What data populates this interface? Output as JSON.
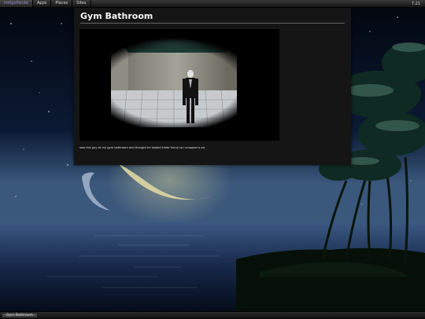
{
  "top_panel": {
    "menu_items": [
      {
        "label": "IndigoPanda"
      },
      {
        "label": "Apps"
      },
      {
        "label": "Places"
      },
      {
        "label": "Sites"
      }
    ],
    "clock": "7:21"
  },
  "window": {
    "title": "Gym Bathroom",
    "caption": "saw this guy at my gym bathroom and thought he looked kinda funny so I snapped a pic"
  },
  "taskbar": {
    "items": [
      {
        "label": "Gym Bathroom"
      }
    ]
  }
}
